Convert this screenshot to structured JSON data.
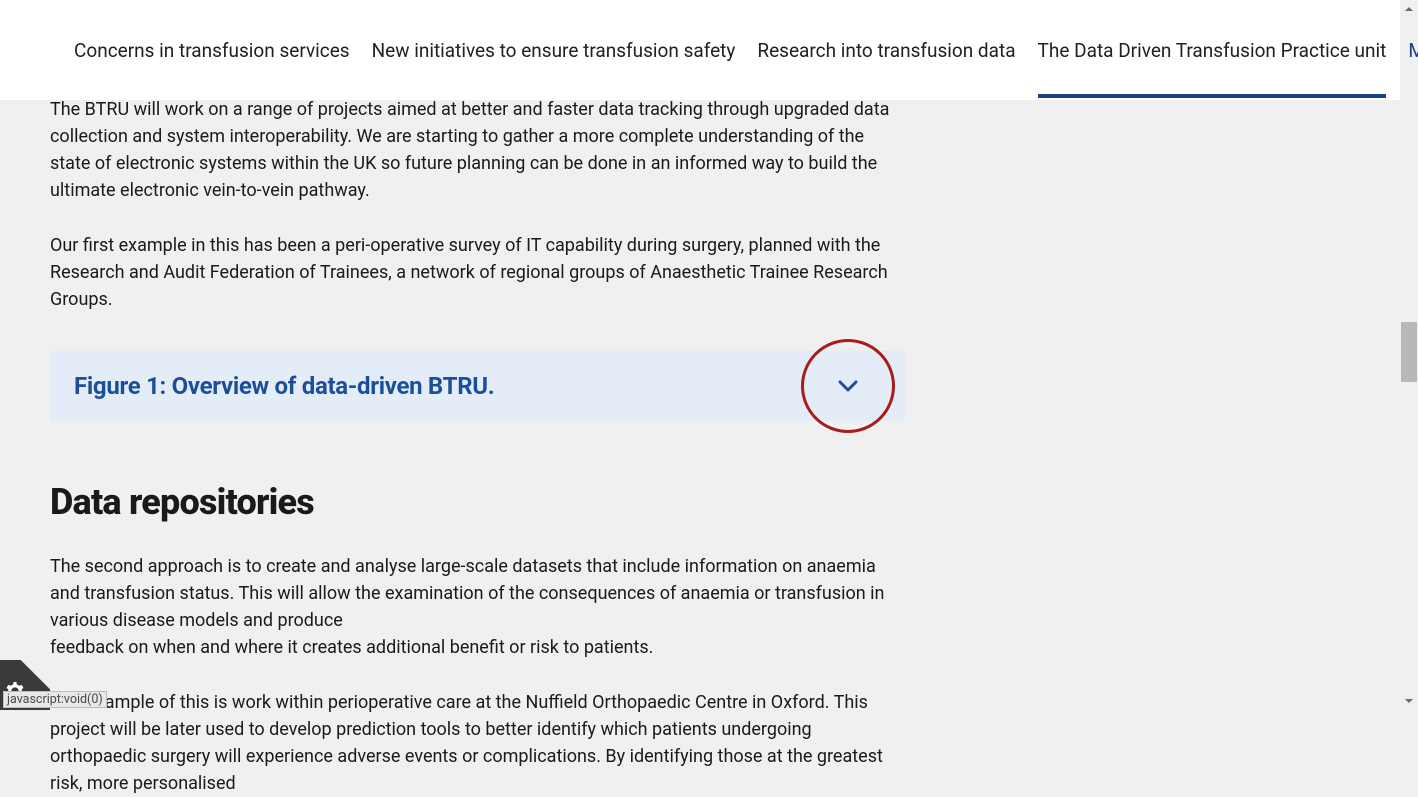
{
  "nav": {
    "items": [
      {
        "label": "Concerns in transfusion services",
        "active": false
      },
      {
        "label": "New initiatives to ensure transfusion safety",
        "active": false
      },
      {
        "label": "Research into transfusion data",
        "active": false
      },
      {
        "label": "The Data Driven Transfusion Practice unit",
        "active": true
      }
    ],
    "more_label": "More…"
  },
  "body": {
    "p1": "The BTRU will work on a range of projects aimed at better and faster data tracking through upgraded data collection and system interoperability. We are starting to gather a more complete understanding of the state of electronic systems within the UK so future planning can be done in an informed way to build the ultimate electronic vein-to-vein pathway.",
    "p2": "Our first example in this has been a peri-operative survey of IT capability during surgery, planned with the Research and Audit Federation of Trainees, a network of regional groups of Anaesthetic Trainee Research Groups.",
    "accordion_title": "Figure 1: Overview of data-driven BTRU.",
    "h2": "Data repositories",
    "p3a": "The second approach is to create and analyse large-scale datasets that include information on anaemia and transfusion status. This will allow the examination of the consequences of anaemia or transfusion in various disease models and produce",
    "p3b": "feedback on when and where it creates additional benefit or risk to patients.",
    "p4": "One example of this is work within perioperative care at the Nuffield Orthopaedic Centre in Oxford. This project will be later used to develop prediction tools to better identify which patients undergoing orthopaedic surgery will experience adverse events or complications. By identifying those at the greatest risk, more personalised"
  },
  "status_text": "javascript:void(0)"
}
